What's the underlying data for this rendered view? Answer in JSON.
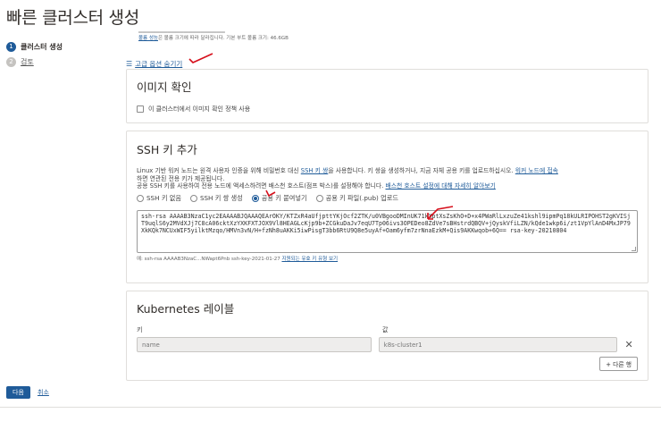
{
  "page": {
    "title": "빠른 클러스터 생성"
  },
  "steps": [
    {
      "num": "1",
      "label": "클러스터 생성",
      "state": "active"
    },
    {
      "num": "2",
      "label": "검토",
      "state": "inactive"
    }
  ],
  "boot_volume": {
    "note_link": "볼륨 성능",
    "note_text": "은 볼륨 크기에 따라 달라집니다. 기본 부트 볼륨 크기: 46.6GB"
  },
  "advanced": {
    "label": "고급 옵션 숨기기",
    "icon": "sliders-icon"
  },
  "image_verify": {
    "title": "이미지 확인",
    "checkbox_label": "이 클러스터에서 이미지 확인 정책 사용"
  },
  "ssh": {
    "title": "SSH 키 추가",
    "desc1_a": "Linux 기반 워커 노드는 원격 사용자 인증을 위해 비밀번호 대신 ",
    "desc1_link": "SSH 키 쌍",
    "desc1_b": "을 사용합니다. 키 쌍을 생성하거나, 지금 자체 공용 키를 업로드하십시오. ",
    "desc1_link2": "워커 노드에 접속",
    "desc2": "하면 연관된 전용 키가 제공됩니다.",
    "desc3_a": "공용 SSH 키를 사용하여 전용 노드에 액세스하려면 배스천 호스트(점프 박스)를 설정해야 합니다. ",
    "desc3_link": "배스천 호스트 설정에 대해 자세히 알아보기",
    "options": [
      "SSH 키 없음",
      "SSH 키 쌍 생성",
      "공용 키 붙여넣기",
      "공용 키 파일(.pub) 업로드"
    ],
    "selected": 2,
    "key_value": "ssh-rsa AAAAB3NzaC1yc2EAAAABJQAAAQEArOKY/KTZxR4aUfjpttYKjOcf2ZTK/u0VBgooDMInUK71kXptXsZsKhO+D+x4PWaRlLxzuZe41kshl9ipmPq18kULRIPOHST2gKVISjT9uqlS6y2MVdXJj7C8cA06cktXzYXKFXTJOX9Vl8HEAGLcKjp9b+ZCGkuDaJv7eqU7Tp06ivs3OPEDeo8ZdVe7sBHstrdQBQV+jQyskVfiLZN/kQde1wkp6i/zt1VpYlAnD4MxJP79XkKQk7NCUxWIF5yilktMzqo/HMVn3vN/H+fzNh8uAKKi5iwPisgT3bb6RtU9Q8e5uyAf+Oam6yfm7zrNnaEzkM+Qis9AKKwqob+6Q== rsa-key-20210804",
    "example_prefix": "예: ssh-rsa AAAAB3NzaC...NWapt6Pnb ssh-key-2021-01-27 ",
    "example_link": "지원되는 유효 키 유형 보기"
  },
  "k8s": {
    "title": "Kubernetes 레이블",
    "key_header": "키",
    "value_header": "값",
    "key_value": "name",
    "value_value": "k8s-cluster1",
    "remove_label": "✕",
    "add_label": "+ 다른 행"
  },
  "footer": {
    "next": "다음",
    "cancel": "취소"
  },
  "colors": {
    "accent": "#1f5b99",
    "annotation": "#d6101c"
  }
}
